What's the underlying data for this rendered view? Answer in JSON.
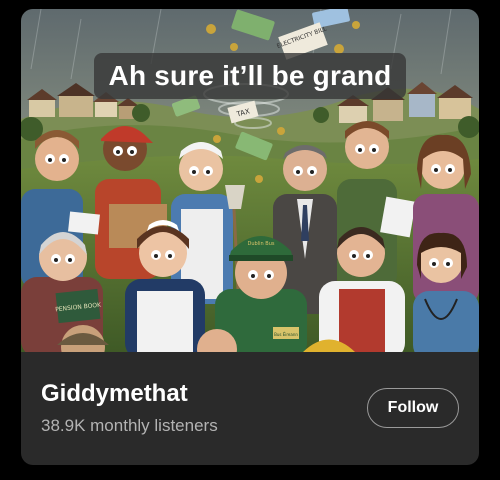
{
  "artwork": {
    "caption": "Ah sure it’ll be grand",
    "signs": {
      "bill": "ELECTRICITY BILL",
      "tax": "TAX",
      "pension": "PENSION BOOK",
      "bus": "Dublin Bus",
      "bus_badge": "Bus Éireann"
    }
  },
  "artist": {
    "name": "Giddymethat",
    "monthly_listeners": "38.9K monthly listeners"
  },
  "actions": {
    "follow_label": "Follow"
  }
}
